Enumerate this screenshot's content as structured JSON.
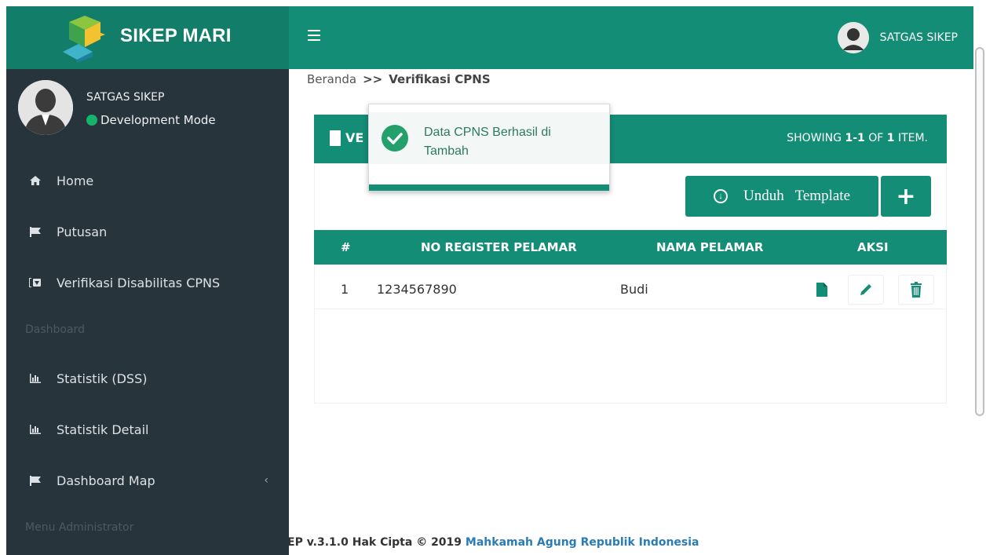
{
  "app": {
    "title": "SIKEP MARI"
  },
  "header": {
    "user_name": "SATGAS SIKEP"
  },
  "sidebar": {
    "profile": {
      "name": "SATGAS SIKEP",
      "mode": "Development Mode"
    },
    "items": [
      {
        "label": "Home",
        "icon": "home-icon"
      },
      {
        "label": "Putusan",
        "icon": "flag-icon"
      },
      {
        "label": "Verifikasi Disabilitas CPNS",
        "icon": "id-card-icon"
      },
      {
        "label": "Statistik (DSS)",
        "icon": "bar-chart-icon"
      },
      {
        "label": "Statistik Detail",
        "icon": "bar-chart-icon"
      },
      {
        "label": "Dashboard Map",
        "icon": "flag-icon"
      }
    ],
    "headers": {
      "dashboard": "Dashboard",
      "admin": "Menu Administrator"
    },
    "chevron": "‹"
  },
  "breadcrumb": {
    "home": "Beranda",
    "separator": ">>",
    "current": "Verifikasi CPNS"
  },
  "box": {
    "title_partial": "VE",
    "showing_prefix": "SHOWING",
    "showing_range": "1-1",
    "showing_of": "OF",
    "showing_total": "1",
    "showing_suffix": "ITEM."
  },
  "buttons": {
    "template": "Unduh   Template",
    "add": "+"
  },
  "table": {
    "headers": [
      "#",
      "NO REGISTER PELAMAR",
      "NAMA PELAMAR",
      "AKSI"
    ],
    "rows": [
      {
        "no": "1",
        "register": "1234567890",
        "nama": "Budi"
      }
    ]
  },
  "toast": {
    "message": "Data CPNS Berhasil di Tambah"
  },
  "footer": {
    "version": "EP v.3.1.0 Hak Cipta © 2019",
    "org": "Mahkamah Agung Republik Indonesia"
  },
  "colors": {
    "primary": "#148d76",
    "sidebar": "#28343c",
    "success": "#23a06c",
    "link": "#2a7cb7"
  }
}
